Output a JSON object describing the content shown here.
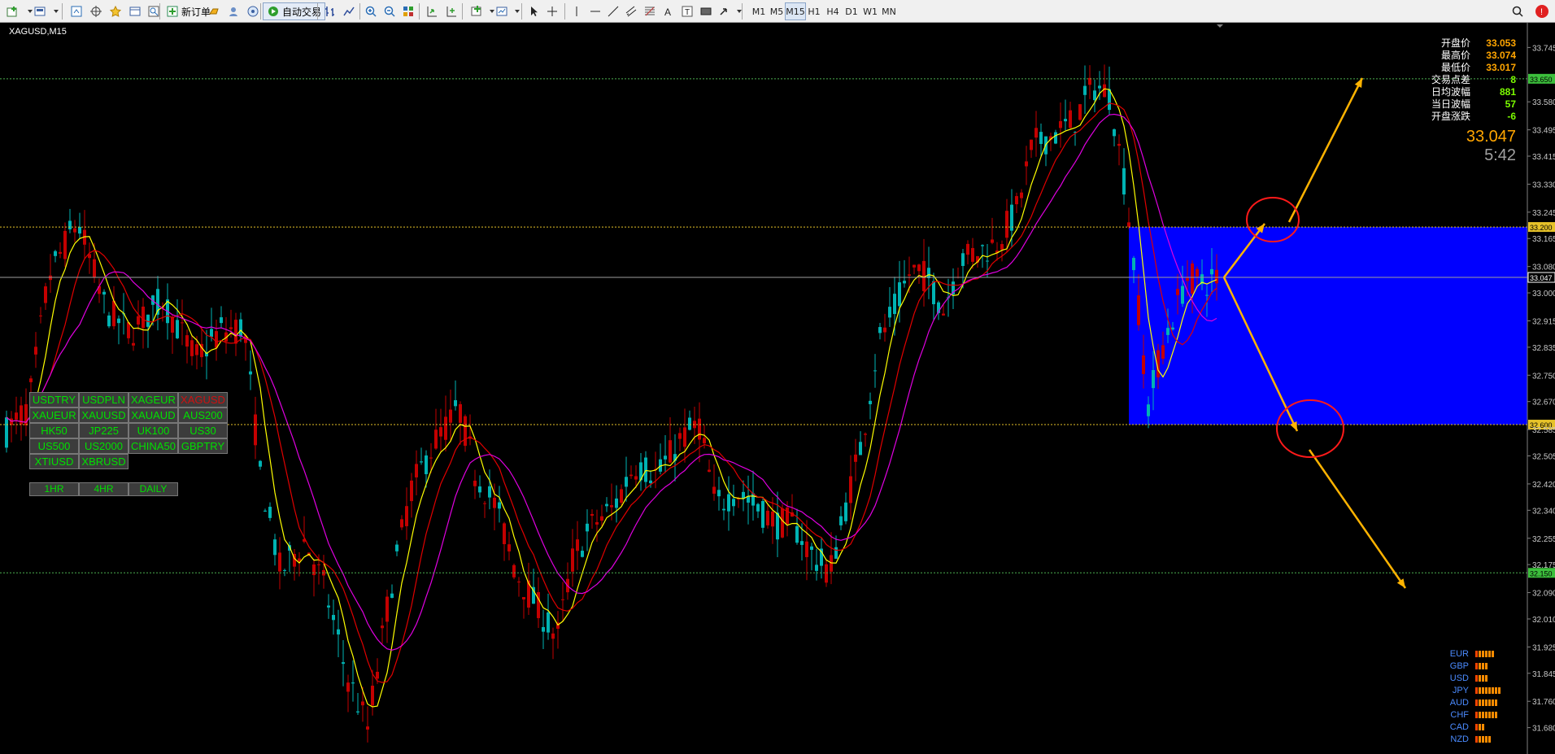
{
  "toolbar": {
    "new_order": "新订单",
    "auto_trading": "自动交易",
    "timeframes": [
      "M1",
      "M5",
      "M15",
      "H1",
      "H4",
      "D1",
      "W1",
      "MN"
    ],
    "active_timeframe": "M15"
  },
  "chart": {
    "symbol_title": "XAGUSD,M15",
    "price_axis": [
      "33.745",
      "33.580",
      "33.495",
      "33.415",
      "33.330",
      "33.245",
      "33.165",
      "33.080",
      "33.000",
      "32.915",
      "32.835",
      "32.750",
      "32.670",
      "32.585",
      "32.505",
      "32.420",
      "32.340",
      "32.255",
      "32.175",
      "32.090",
      "32.010",
      "31.925",
      "31.845",
      "31.760",
      "31.680"
    ],
    "price_range": [
      31.6,
      33.82
    ],
    "levels": [
      {
        "price": 33.65,
        "label": "33.650",
        "style": "dotted",
        "color": "#4caf50"
      },
      {
        "price": 33.2,
        "label": "33.200",
        "style": "dotted",
        "color": "#e6c229"
      },
      {
        "price": 33.047,
        "label": "33.047",
        "style": "solid",
        "color": "#9e9e9e"
      },
      {
        "price": 32.6,
        "label": "32.600",
        "style": "dotted",
        "color": "#e6c229"
      },
      {
        "price": 32.15,
        "label": "32.150",
        "style": "dotted",
        "color": "#4caf50"
      }
    ],
    "zone": {
      "price_top": 33.2,
      "price_bottom": 32.6,
      "color": "#0000ff"
    },
    "colors": {
      "bull": "#00b3b3",
      "bear": "#c40000",
      "ma_fast": "#ffff00",
      "ma_mid": "#e00000",
      "ma_slow": "#e000e0",
      "arrow": "#ffb300",
      "circle": "#ff1a1a"
    }
  },
  "info_panel": [
    {
      "label": "开盘价",
      "value": "33.053"
    },
    {
      "label": "最高价",
      "value": "33.074"
    },
    {
      "label": "最低价",
      "value": "33.017"
    },
    {
      "label": "交易点差",
      "value": "8"
    },
    {
      "label": "日均波幅",
      "value": "881"
    },
    {
      "label": "当日波幅",
      "value": "57"
    },
    {
      "label": "开盘涨跌",
      "value": "-6"
    }
  ],
  "current_price": "33.047",
  "countdown": "5:42",
  "symbols": [
    "USDTRY",
    "USDPLN",
    "XAGEUR",
    "XAGUSD",
    "XAUEUR",
    "XAUUSD",
    "XAUAUD",
    "AUS200",
    "HK50",
    "JP225",
    "UK100",
    "US30",
    "US500",
    "US2000",
    "CHINA50",
    "GBPTRY",
    "XTIUSD",
    "XBRUSD"
  ],
  "active_symbol": "XAGUSD",
  "timeframe_buttons": [
    "1HR",
    "4HR",
    "DAILY"
  ],
  "currency_strength": [
    {
      "name": "EUR",
      "bars": 6
    },
    {
      "name": "GBP",
      "bars": 4
    },
    {
      "name": "USD",
      "bars": 4
    },
    {
      "name": "JPY",
      "bars": 8
    },
    {
      "name": "AUD",
      "bars": 7
    },
    {
      "name": "CHF",
      "bars": 7
    },
    {
      "name": "CAD",
      "bars": 3
    },
    {
      "name": "NZD",
      "bars": 5
    }
  ]
}
